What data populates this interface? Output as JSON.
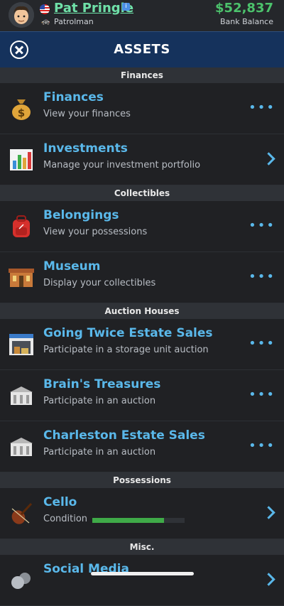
{
  "status": {
    "player_name": "Pat Pringle",
    "job_title": "Patrolman",
    "balance": "$52,837",
    "balance_label": "Bank Balance"
  },
  "header": {
    "title": "ASSETS"
  },
  "sections": [
    {
      "label": "Finances",
      "rows": [
        {
          "title": "Finances",
          "subtitle": "View your finances",
          "icon": "money-bag-icon",
          "action": "dots"
        },
        {
          "title": "Investments",
          "subtitle": "Manage your investment portfolio",
          "icon": "bar-chart-icon",
          "action": "chevron"
        }
      ]
    },
    {
      "label": "Collectibles",
      "rows": [
        {
          "title": "Belongings",
          "subtitle": "View your possessions",
          "icon": "backpack-icon",
          "action": "dots"
        },
        {
          "title": "Museum",
          "subtitle": "Display your collectibles",
          "icon": "museum-icon",
          "action": "dots"
        }
      ]
    },
    {
      "label": "Auction Houses",
      "rows": [
        {
          "title": "Going Twice Estate Sales",
          "subtitle": "Participate in a storage unit auction",
          "icon": "storage-unit-icon",
          "action": "dots"
        },
        {
          "title": "Brain's Treasures",
          "subtitle": "Participate in an auction",
          "icon": "auction-house-icon",
          "action": "dots"
        },
        {
          "title": "Charleston Estate Sales",
          "subtitle": "Participate in an auction",
          "icon": "auction-house-icon",
          "action": "dots"
        }
      ]
    },
    {
      "label": "Possessions",
      "rows": [
        {
          "title": "Cello",
          "subtitle": "Condition",
          "icon": "violin-icon",
          "action": "chevron",
          "condition": 0.78
        }
      ]
    },
    {
      "label": "Misc.",
      "rows": [
        {
          "title": "Social Media",
          "subtitle": "",
          "icon": "social-media-icon",
          "action": "chevron"
        }
      ]
    }
  ],
  "colors": {
    "accent": "#5ab8ea",
    "balance": "#4cc26c",
    "name": "#6fe0a8",
    "header_bg": "#15325c",
    "condition_fill": "#3faa48"
  }
}
